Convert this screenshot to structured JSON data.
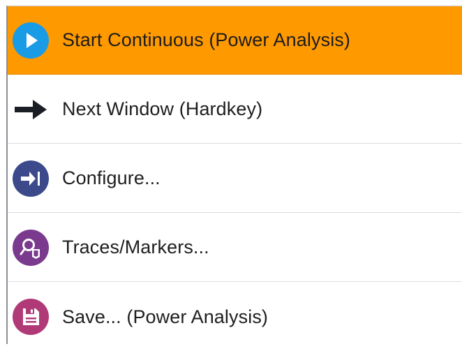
{
  "menu": {
    "items": [
      {
        "label": "Start Continuous (Power Analysis)",
        "icon": "play-icon",
        "active": true
      },
      {
        "label": "Next Window (Hardkey)",
        "icon": "arrow-right-icon",
        "active": false
      },
      {
        "label": "Configure...",
        "icon": "configure-icon",
        "active": false
      },
      {
        "label": "Traces/Markers...",
        "icon": "traces-markers-icon",
        "active": false
      },
      {
        "label": "Save... (Power Analysis)",
        "icon": "save-icon",
        "active": false
      }
    ]
  },
  "colors": {
    "active_bg": "#ff9900",
    "play_icon": "#1a9be6",
    "configure_icon": "#3c4a8c",
    "traces_icon": "#7a3a8e",
    "save_icon": "#b03a78",
    "arrow": "#1c1e26"
  }
}
